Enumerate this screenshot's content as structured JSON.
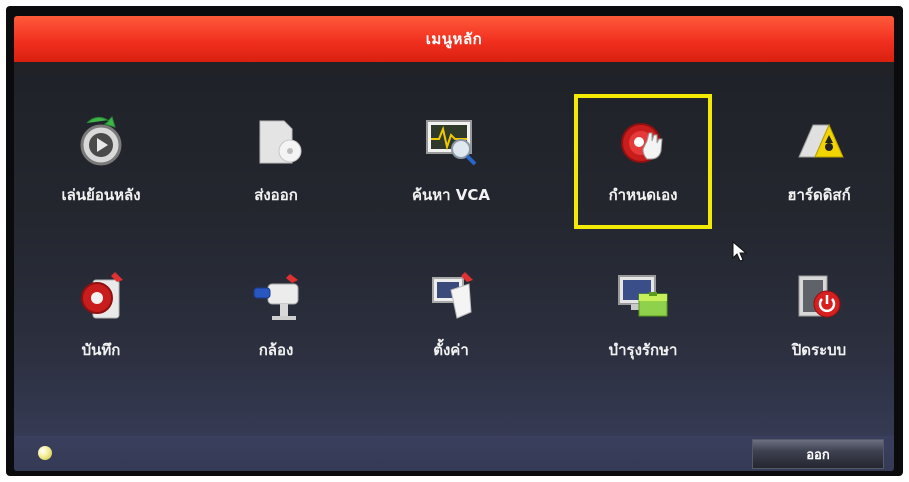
{
  "window": {
    "title": "เมนูหลัก"
  },
  "menu": {
    "items": [
      {
        "label": "เล่นย้อนหลัง",
        "icon": "playback-icon"
      },
      {
        "label": "ส่งออก",
        "icon": "export-icon"
      },
      {
        "label": "ค้นหา VCA",
        "icon": "vca-search-icon"
      },
      {
        "label": "กำหนดเอง",
        "icon": "manual-icon",
        "selected": true
      },
      {
        "label": "ฮาร์ดดิสก์",
        "icon": "hdd-icon"
      },
      {
        "label": "บันทึก",
        "icon": "record-icon"
      },
      {
        "label": "กล้อง",
        "icon": "camera-icon"
      },
      {
        "label": "ตั้งค่า",
        "icon": "configuration-icon"
      },
      {
        "label": "บำรุงรักษา",
        "icon": "maintenance-icon"
      },
      {
        "label": "ปิดระบบ",
        "icon": "shutdown-icon"
      }
    ]
  },
  "footer": {
    "exit_label": "ออก"
  },
  "colors": {
    "title_bar": "#f1301f",
    "highlight": "#f2ea00",
    "background": "#24272f"
  }
}
